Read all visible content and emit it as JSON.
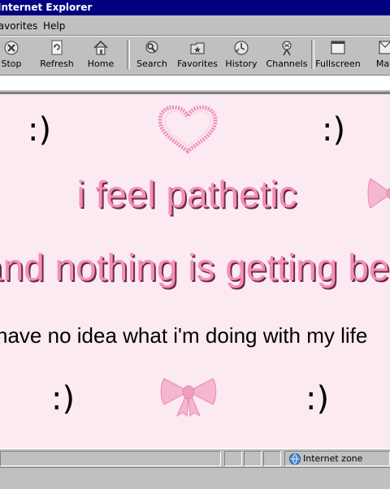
{
  "window": {
    "title": "Internet Explorer"
  },
  "menu": {
    "favorites": "Favorites",
    "help": "Help"
  },
  "toolbar": {
    "buttons": [
      {
        "label": "Stop",
        "icon": "stop-icon"
      },
      {
        "label": "Refresh",
        "icon": "refresh-icon"
      },
      {
        "label": "Home",
        "icon": "home-icon"
      },
      {
        "label": "Search",
        "icon": "search-icon"
      },
      {
        "label": "Favorites",
        "icon": "favorites-icon"
      },
      {
        "label": "History",
        "icon": "history-icon"
      },
      {
        "label": "Channels",
        "icon": "channels-icon"
      },
      {
        "label": "Fullscreen",
        "icon": "fullscreen-icon"
      },
      {
        "label": "Mail",
        "icon": "mail-icon"
      }
    ]
  },
  "page": {
    "smiley": ":)",
    "line1": "i feel pathetic",
    "line2": "and nothing is getting better",
    "line3": "i have no idea what i'm doing with my life",
    "colors": {
      "background": "#fbeaf1",
      "pink_text": "#f48fb7",
      "heart": "#f08cb8",
      "bow": "#f7b6cf"
    }
  },
  "statusbar": {
    "zone": "Internet zone"
  }
}
